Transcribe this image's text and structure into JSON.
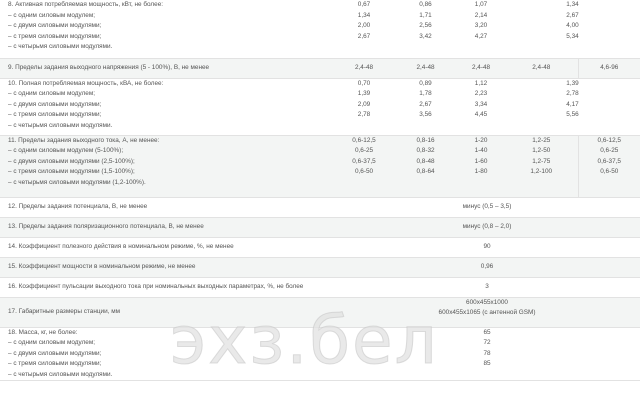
{
  "rows": [
    {
      "label_lines": [
        "8. Активная потребляемая мощность, кВт, не более:",
        "– с одним силовым модулем;",
        "– с двумя силовыми модулями;",
        "– с тремя силовыми модулями;",
        "– с четырьмя силовыми модулями."
      ],
      "c1": [
        "",
        "0,67",
        "1,34",
        "2,00",
        "2,67"
      ],
      "c2": [
        "",
        "0,86",
        "1,71",
        "2,56",
        "3,42"
      ],
      "c3": [
        "",
        "1,07",
        "2,14",
        "3,20",
        "4,27"
      ],
      "c45": [
        "",
        "1,34",
        "2,67",
        "4,00",
        "5,34"
      ]
    },
    {
      "label": "9. Пределы задания выходного напряжения (5 - 100%), В, не менее",
      "c1": "2,4-48",
      "c2": "2,4-48",
      "c3": "2,4-48",
      "c4": "2,4-48",
      "c5": "4,6-96"
    },
    {
      "label_lines": [
        "10. Полная потребляемая мощность, кВА, не более:",
        "– с одним силовым модулем;",
        "– с двумя силовыми модулями;",
        "– с тремя силовыми модулями;",
        "– с четырьмя силовыми модулями."
      ],
      "c1": [
        "",
        "0,70",
        "1,39",
        "2,09",
        "2,78"
      ],
      "c2": [
        "",
        "0,89",
        "1,78",
        "2,67",
        "3,56"
      ],
      "c3": [
        "",
        "1,12",
        "2,23",
        "3,34",
        "4,45"
      ],
      "c45": [
        "",
        "1,39",
        "2,78",
        "4,17",
        "5,56"
      ]
    },
    {
      "label_lines": [
        "11. Пределы задания выходного тока, А, не менее:",
        "– с одним силовым модулем (5-100%);",
        "– с двумя силовыми модулями (2,5-100%);",
        "– с тремя силовыми модулями (1,5-100%);",
        "– с четырьмя силовыми модулями (1,2-100%)."
      ],
      "c1": [
        "",
        "0,6-12,5",
        "0,6-25",
        "0,6-37,5",
        "0,6-50"
      ],
      "c2": [
        "",
        "0,8-16",
        "0,8-32",
        "0,8-48",
        "0,8-64"
      ],
      "c3": [
        "",
        "1-20",
        "1-40",
        "1-60",
        "1-80"
      ],
      "c4": [
        "",
        "1,2-25",
        "1,2-50",
        "1,2-75",
        "1,2-100"
      ],
      "c5": [
        "",
        "0,6-12,5",
        "0,6-25",
        "0,6-37,5",
        "0,6-50"
      ]
    },
    {
      "label": "12. Пределы задания потенциала, В, не менее",
      "value": "минус (0,5 – 3,5)"
    },
    {
      "label": "13. Пределы задания поляризационного потенциала, В, не менее",
      "value": "минус (0,8 – 2,0)"
    },
    {
      "label": "14. Коэффициент полезного действия в номинальном режиме, %, не менее",
      "value": "90"
    },
    {
      "label": "15. Коэффициент мощности в номинальном режиме, не менее",
      "value": "0,96"
    },
    {
      "label": "16. Коэффициент пульсации выходного тока при номинальных выходных параметрах, %, не более",
      "value": "3"
    },
    {
      "label": "17. Габаритные размеры станции, мм",
      "value_lines": [
        "600х455х1000",
        "600х455х1065 (с антенной GSM)"
      ]
    },
    {
      "label_lines": [
        "18. Масса, кг, не более:",
        "– с одним силовым модулем;",
        "– с двумя силовыми модулями;",
        "– с тремя силовыми модулями;",
        "– с четырьмя силовыми модулями."
      ],
      "value_lines": [
        "",
        "65",
        "72",
        "78",
        "85"
      ]
    }
  ],
  "watermark": "эхз.бел"
}
